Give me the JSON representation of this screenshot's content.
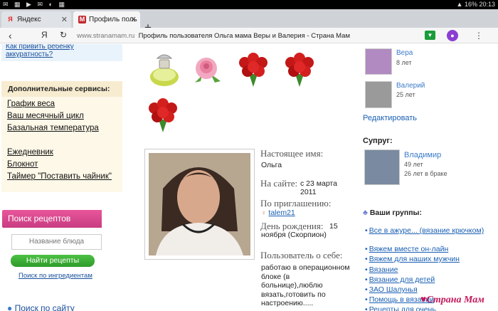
{
  "status": {
    "icons": "✉ ▦ ▶ ✉ ◐ ▦",
    "battery": "16%",
    "time": "20:13",
    "wifi": "▲"
  },
  "tabs": [
    {
      "favicon": "Я",
      "label": "Яндекс",
      "close": "✕"
    },
    {
      "favicon": "M",
      "label": "Профиль поль",
      "close": "✕"
    }
  ],
  "new_tab": "+",
  "address": {
    "back": "‹",
    "yandex": "Я",
    "reload": "↻",
    "domain": "www.stranamam.ru",
    "title": "Профиль пользователя Ольга мама Веры и Валерия - Страна Мам",
    "menu": "⋮"
  },
  "sidebar": {
    "advice_link": "Как привить ребенку аккуратность?",
    "services_title": "Дополнительные сервисы:",
    "services": [
      "График веса",
      "Ваш месячный цикл",
      "Базальная температура"
    ],
    "services2": [
      "Ежедневник",
      "Блокнот",
      "Таймер \"Поставить чайник\""
    ],
    "recipes_title": "Поиск рецептов",
    "dish_placeholder": "Название блюда",
    "find_recipes": "Найти рецепты",
    "by_ingredients": "Поиск по ингредиентам",
    "site_search": "Поиск по сайту"
  },
  "profile": {
    "real_name_label": "Настоящее имя:",
    "real_name": "Ольга",
    "on_site_label": "На сайте:",
    "on_site_value": "с 23 марта 2011",
    "invite_label": "По приглашению:",
    "invite_user": "talem21",
    "birthday_label": "День рождения:",
    "birthday_value": "15 ноября (Скорпион)",
    "about_label": "Пользователь о себе:",
    "about_value": "работаю в операционном блоке (в больнице),люблю вязать,готовить по настроению....."
  },
  "children": [
    {
      "name": "Вера",
      "age": "8 лет"
    },
    {
      "name": "Валерий",
      "age": "25 лет"
    }
  ],
  "edit_label": "Редактировать",
  "spouse": {
    "heading": "Супруг:",
    "name": "Владимир",
    "age": "49 лет",
    "married": "26 лет в браке"
  },
  "groups": {
    "heading": "Ваши группы:",
    "items": [
      "Все в ажуре... (вязание крючком)",
      "Вяжем вместе он-лайн",
      "Вяжем для наших мужчин",
      "Вязание",
      "Вязание для детей",
      "ЗАО Шалунья",
      "Помощь в вязании",
      "Рецепты для очень"
    ]
  },
  "watermark": "Страна Мам"
}
